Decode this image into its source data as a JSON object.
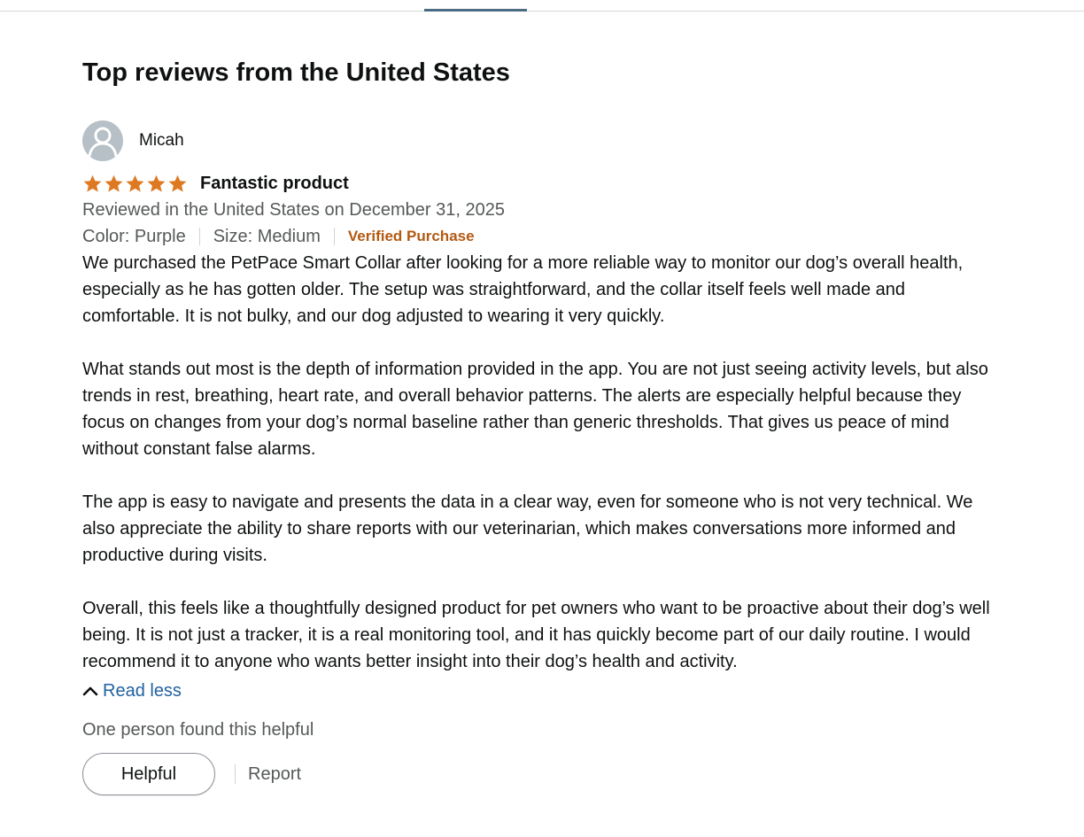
{
  "section": {
    "title": "Top reviews from the United States"
  },
  "review": {
    "author": "Micah",
    "rating": 5,
    "max_rating": 5,
    "title": "Fantastic product",
    "date_text": "Reviewed in the United States on December 31, 2025",
    "color_text": "Color: Purple",
    "size_text": "Size: Medium",
    "verified_text": "Verified Purchase",
    "body": [
      "We purchased the PetPace Smart Collar after looking for a more reliable way to monitor our dog’s overall health, especially as he has gotten older. The setup was straightforward, and the collar itself feels well made and comfortable. It is not bulky, and our dog adjusted to wearing it very quickly.",
      "What stands out most is the depth of information provided in the app. You are not just seeing activity levels, but also trends in rest, breathing, heart rate, and overall behavior patterns. The alerts are especially helpful because they focus on changes from your dog’s normal baseline rather than generic thresholds. That gives us peace of mind without constant false alarms.",
      "The app is easy to navigate and presents the data in a clear way, even for someone who is not very technical. We also appreciate the ability to share reports with our veterinarian, which makes conversations more informed and productive during visits.",
      "Overall, this feels like a thoughtfully designed product for pet owners who want to be proactive about their dog’s well being. It is not just a tracker, it is a real monitoring tool, and it has quickly become part of our daily routine. I would recommend it to anyone who wants better insight into their dog’s health and activity."
    ],
    "read_less_label": "Read less",
    "helpful_text": "One person found this helpful",
    "helpful_button_label": "Helpful",
    "report_label": "Report"
  },
  "icons": {
    "avatar": "person-silhouette-icon",
    "star": "star-icon",
    "read_less": "chevron-up-icon"
  },
  "colors": {
    "star": "#de7921",
    "verified": "#b25a12",
    "link": "#2162a1",
    "secondary_text": "#565959",
    "primary_text": "#0f1111"
  }
}
